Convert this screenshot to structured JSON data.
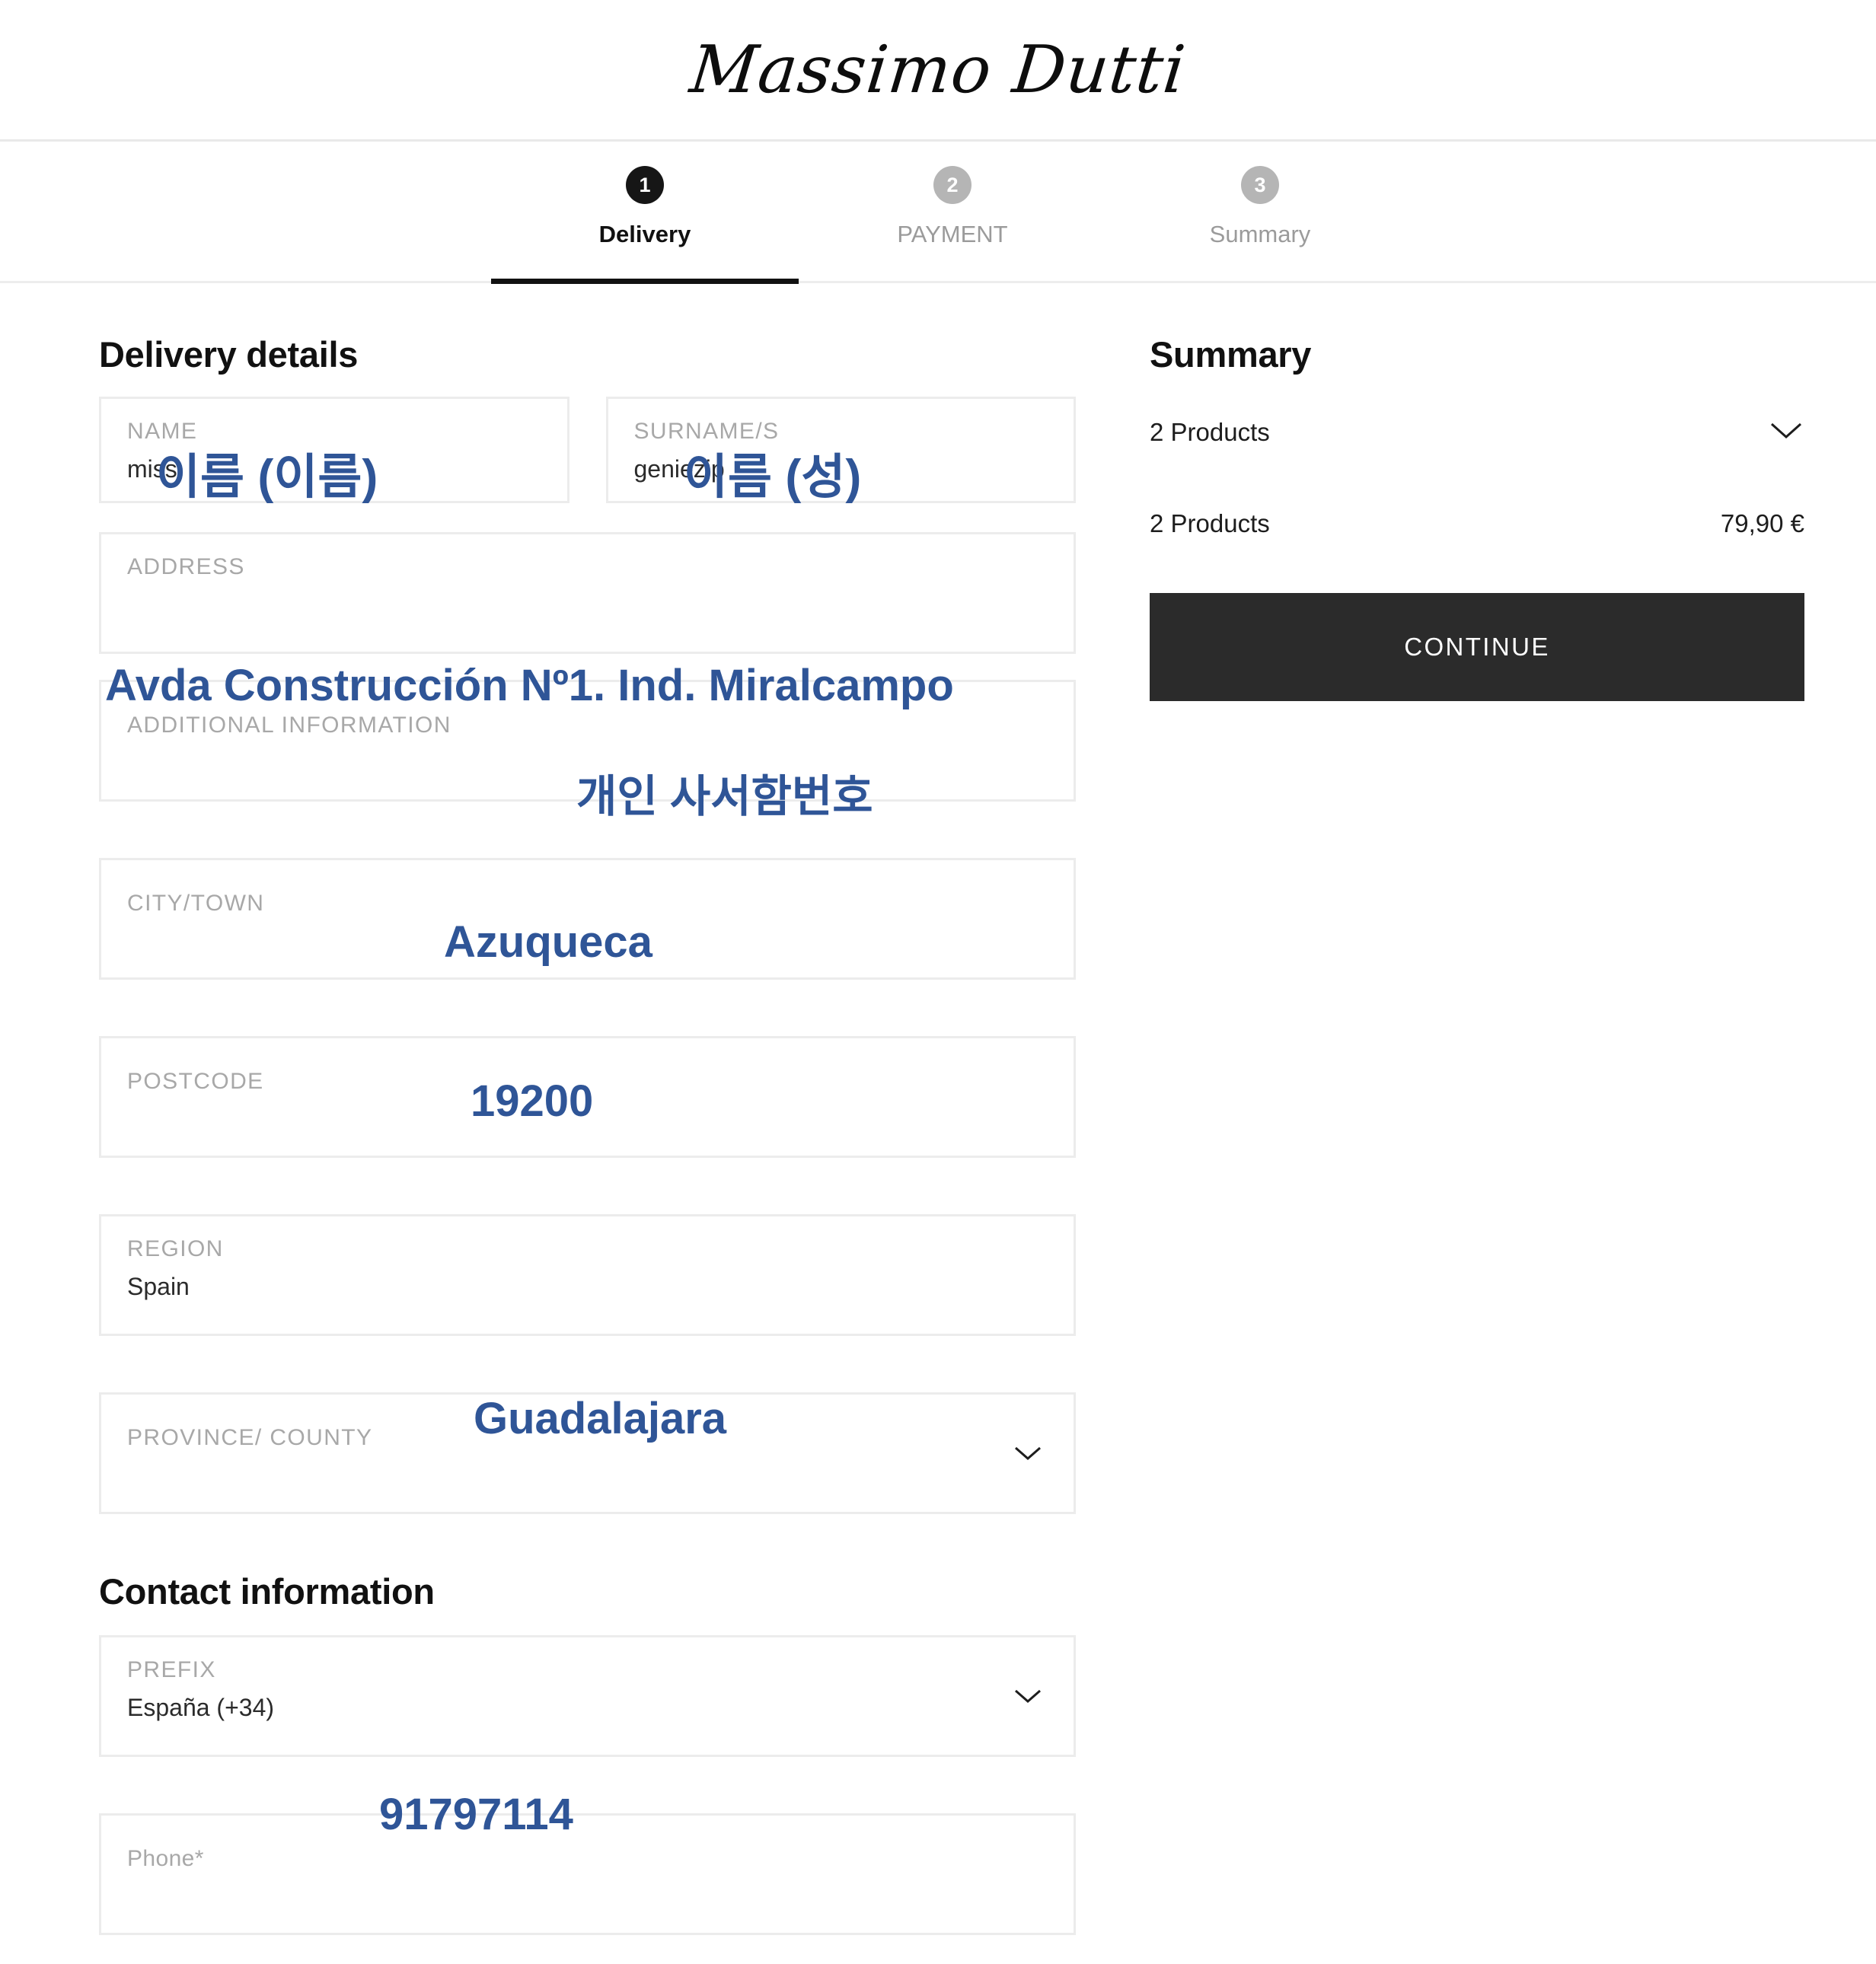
{
  "brand": {
    "name": "Massimo Dutti"
  },
  "steps": [
    {
      "number": "1",
      "label": "Delivery",
      "active": true
    },
    {
      "number": "2",
      "label": "PAYMENT",
      "active": false
    },
    {
      "number": "3",
      "label": "Summary",
      "active": false
    }
  ],
  "delivery": {
    "title": "Delivery details",
    "fields": {
      "name": {
        "label": "NAME",
        "value": "miss"
      },
      "surname": {
        "label": "SURNAME/S",
        "value": "geniezip"
      },
      "address": {
        "label": "ADDRESS",
        "value": ""
      },
      "additional": {
        "label": "ADDITIONAL INFORMATION",
        "value": ""
      },
      "city": {
        "label": "CITY/TOWN",
        "value": ""
      },
      "postcode": {
        "label": "POSTCODE",
        "value": ""
      },
      "region": {
        "label": "REGION",
        "value": "Spain"
      },
      "province": {
        "label": "PROVINCE/ COUNTY",
        "value": ""
      }
    }
  },
  "contact": {
    "title": "Contact information",
    "fields": {
      "prefix": {
        "label": "PREFIX",
        "value": "España (+34)"
      },
      "phone": {
        "label": "Phone*",
        "value": ""
      }
    }
  },
  "summary": {
    "title": "Summary",
    "products_toggle_label": "2 Products",
    "products_line_label": "2 Products",
    "products_line_amount": "79,90 €",
    "continue_label": "CONTINUE"
  },
  "annotations": {
    "name": "이름 (이름)",
    "surname": "이름 (성)",
    "address": "Avda Construcción Nº1. Ind. Miralcampo",
    "additional": "개인 사서함번호",
    "city": "Azuqueca",
    "postcode": "19200",
    "province": "Guadalajara",
    "phone": "91797114"
  },
  "colors": {
    "annotation_blue": "#2f5597",
    "accent_dark": "#2b2b2b",
    "muted_label": "#a8a8a8",
    "border": "#ececec"
  }
}
